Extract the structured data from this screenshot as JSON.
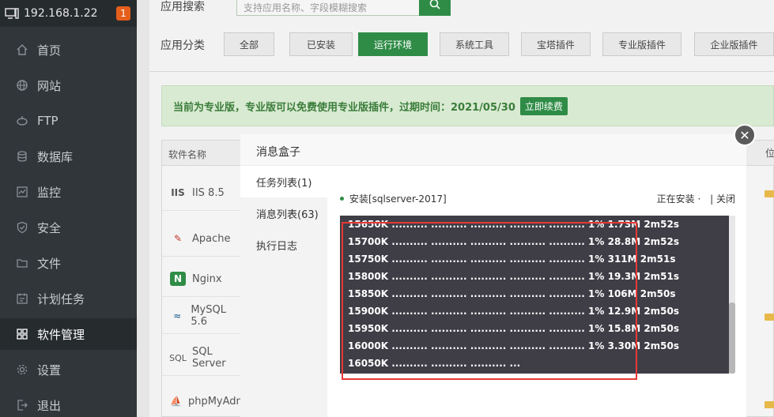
{
  "sidebar": {
    "ip": "192.168.1.22",
    "badge": "1",
    "items": [
      {
        "label": "首页",
        "icon": "home-icon"
      },
      {
        "label": "网站",
        "icon": "globe-icon"
      },
      {
        "label": "FTP",
        "icon": "ftp-icon"
      },
      {
        "label": "数据库",
        "icon": "database-icon"
      },
      {
        "label": "监控",
        "icon": "monitor-icon"
      },
      {
        "label": "安全",
        "icon": "shield-icon"
      },
      {
        "label": "文件",
        "icon": "folder-icon"
      },
      {
        "label": "计划任务",
        "icon": "calendar-icon"
      },
      {
        "label": "软件管理",
        "icon": "grid-icon"
      },
      {
        "label": "设置",
        "icon": "gear-icon"
      },
      {
        "label": "退出",
        "icon": "logout-icon"
      }
    ]
  },
  "search": {
    "label": "应用搜索",
    "placeholder": "支持应用名称、字段模糊搜索"
  },
  "category": {
    "label": "应用分类",
    "buttons": [
      "全部",
      "已安装",
      "运行环境",
      "系统工具",
      "宝塔插件",
      "专业版插件",
      "企业版插件"
    ]
  },
  "notice": {
    "text": "当前为专业版，专业版可以免费使用专业版插件，过期时间：2021/05/30",
    "renew": "立即续费"
  },
  "table": {
    "header": "软件名称",
    "right_header": "位",
    "rows": [
      {
        "logo": "IIS",
        "name": "IIS 8.5"
      },
      {
        "logo": "✎",
        "name": "Apache"
      },
      {
        "logo": "N",
        "name": "Nginx"
      },
      {
        "logo": "≈",
        "name": "MySQL 5.6"
      },
      {
        "logo": "SQL",
        "name": "SQL Server"
      },
      {
        "logo": "⛵",
        "name": "phpMyAdmin"
      }
    ]
  },
  "modal": {
    "title": "消息盒子",
    "menu": [
      "任务列表(1)",
      "消息列表(63)",
      "执行日志"
    ],
    "task_name": "安装[sqlserver-2017]",
    "status": "正在安装 ·",
    "close_link": "| 关闭",
    "close_glyph": "✕",
    "log": [
      "15650K .......... .......... .......... .......... .......... 1% 1.73M 2m52s",
      "15700K .......... .......... .......... .......... .......... 1% 28.8M 2m52s",
      "15750K .......... .......... .......... .......... .......... 1% 311M 2m51s",
      "15800K .......... .......... .......... .......... .......... 1% 19.3M 2m51s",
      "15850K .......... .......... .......... .......... .......... 1% 106M 2m50s",
      "15900K .......... .......... .......... .......... .......... 1% 12.9M 2m50s",
      "15950K .......... .......... .......... .......... .......... 1% 15.8M 2m50s",
      "16000K .......... .......... .......... .......... .......... 1% 3.30M 2m50s",
      "16050K .......... .......... .......... ..."
    ]
  }
}
